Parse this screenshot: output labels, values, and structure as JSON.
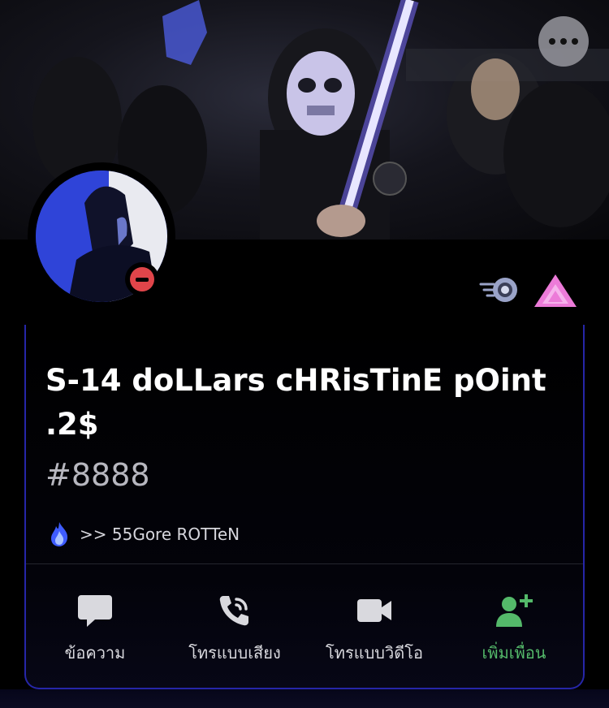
{
  "header": {
    "more_button_icon": "more-horizontal-icon"
  },
  "profile": {
    "display_name": "S-14 doLLars cHRisTinE pOint .2$",
    "tag": "#8888",
    "status": "do-not-disturb",
    "badges": [
      {
        "icon": "speed-boost-icon"
      },
      {
        "icon": "nitro-triangle-icon"
      }
    ],
    "custom_status": {
      "icon": "blue-fire-icon",
      "text": ">> 55Gore ROTTeN"
    }
  },
  "actions": [
    {
      "label": "ข้อความ",
      "icon": "message-icon"
    },
    {
      "label": "โทรแบบเสียง",
      "icon": "voice-call-icon"
    },
    {
      "label": "โทรแบบวิดีโอ",
      "icon": "video-call-icon"
    },
    {
      "label": "เพิ่มเพื่อน",
      "icon": "add-friend-icon"
    }
  ],
  "colors": {
    "accent_border": "#2626a8",
    "dnd_red": "#e0454a",
    "add_friend_green": "#54b96a",
    "nitro_pink": "#ec7bd8"
  }
}
